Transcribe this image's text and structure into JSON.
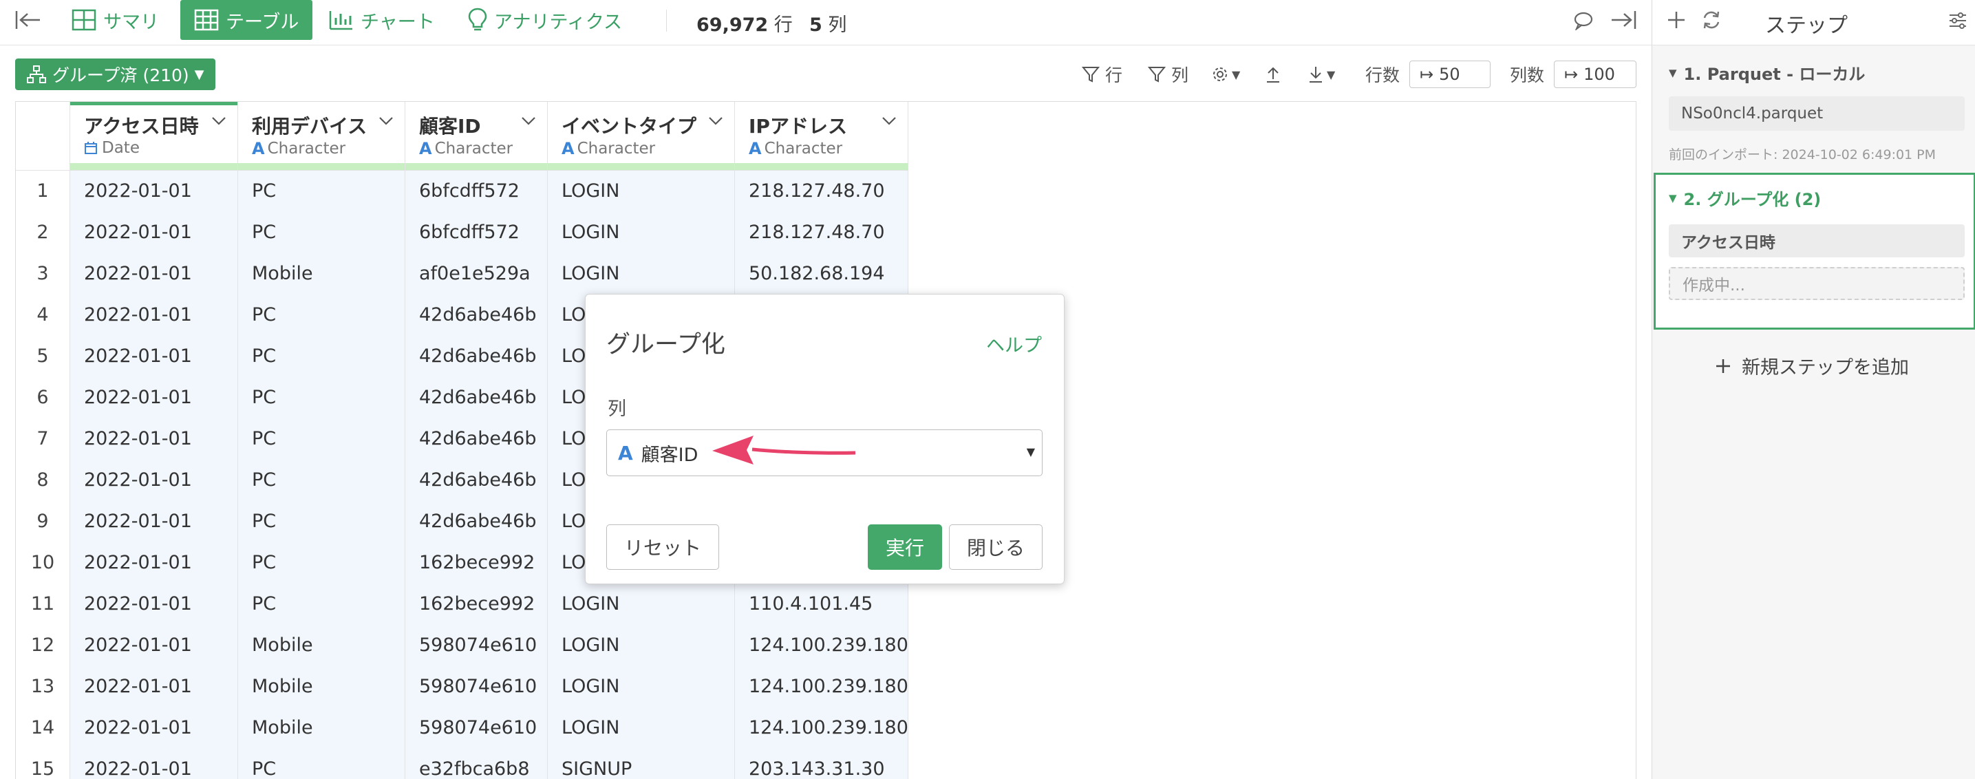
{
  "toolbar": {
    "tabs": [
      {
        "label": "サマリ",
        "icon": "grid-icon"
      },
      {
        "label": "テーブル",
        "icon": "table-icon",
        "active": true
      },
      {
        "label": "チャート",
        "icon": "bar-chart-icon"
      },
      {
        "label": "アナリティクス",
        "icon": "lightbulb-icon"
      }
    ],
    "row_count": "69,972",
    "row_unit": "行",
    "col_count": "5",
    "col_unit": "列"
  },
  "subbar": {
    "group_badge": "グループ済 (210)",
    "row_filter": "行",
    "col_filter": "列",
    "rows_label": "行数",
    "rows_value": "50",
    "cols_label": "列数",
    "cols_value": "100"
  },
  "table": {
    "columns": [
      {
        "name": "アクセス日時",
        "type": "Date",
        "type_icon": "calendar-icon"
      },
      {
        "name": "利用デバイス",
        "type": "Character",
        "type_icon": "A"
      },
      {
        "name": "顧客ID",
        "type": "Character",
        "type_icon": "A"
      },
      {
        "name": "イベントタイプ",
        "type": "Character",
        "type_icon": "A"
      },
      {
        "name": "IPアドレス",
        "type": "Character",
        "type_icon": "A"
      }
    ],
    "rows": [
      [
        "1",
        "2022-01-01",
        "PC",
        "6bfcdff572",
        "LOGIN",
        "218.127.48.70"
      ],
      [
        "2",
        "2022-01-01",
        "PC",
        "6bfcdff572",
        "LOGIN",
        "218.127.48.70"
      ],
      [
        "3",
        "2022-01-01",
        "Mobile",
        "af0e1e529a",
        "LOGIN",
        "50.182.68.194"
      ],
      [
        "4",
        "2022-01-01",
        "PC",
        "42d6abe46b",
        "LO",
        ""
      ],
      [
        "5",
        "2022-01-01",
        "PC",
        "42d6abe46b",
        "LO",
        ""
      ],
      [
        "6",
        "2022-01-01",
        "PC",
        "42d6abe46b",
        "LO",
        ""
      ],
      [
        "7",
        "2022-01-01",
        "PC",
        "42d6abe46b",
        "LO",
        ""
      ],
      [
        "8",
        "2022-01-01",
        "PC",
        "42d6abe46b",
        "LO",
        ""
      ],
      [
        "9",
        "2022-01-01",
        "PC",
        "42d6abe46b",
        "LO",
        ""
      ],
      [
        "10",
        "2022-01-01",
        "PC",
        "162bece992",
        "LO",
        ""
      ],
      [
        "11",
        "2022-01-01",
        "PC",
        "162bece992",
        "LOGIN",
        "110.4.101.45"
      ],
      [
        "12",
        "2022-01-01",
        "Mobile",
        "598074e610",
        "LOGIN",
        "124.100.239.180"
      ],
      [
        "13",
        "2022-01-01",
        "Mobile",
        "598074e610",
        "LOGIN",
        "124.100.239.180"
      ],
      [
        "14",
        "2022-01-01",
        "Mobile",
        "598074e610",
        "LOGIN",
        "124.100.239.180"
      ],
      [
        "15",
        "2022-01-01",
        "PC",
        "e32fbca6b8",
        "SIGNUP",
        "203.143.31.30"
      ]
    ]
  },
  "dialog": {
    "title": "グループ化",
    "help": "ヘルプ",
    "column_label": "列",
    "selected_column": "顧客ID",
    "reset": "リセット",
    "run": "実行",
    "close": "閉じる"
  },
  "panel": {
    "title": "ステップ",
    "step1_title": "1. Parquet - ローカル",
    "step1_file": "NSo0ncl4.parquet",
    "step1_meta": "前回のインポート: 2024-10-02 6:49:01 PM",
    "step2_title": "2. グループ化 (2)",
    "step2_item": "アクセス日時",
    "step2_pending": "作成中...",
    "add_step": "新規ステップを追加"
  },
  "colors": {
    "accent": "#45a86b",
    "link": "#3aa065",
    "type_icon": "#3c85d6",
    "arrow": "#e8416a"
  }
}
